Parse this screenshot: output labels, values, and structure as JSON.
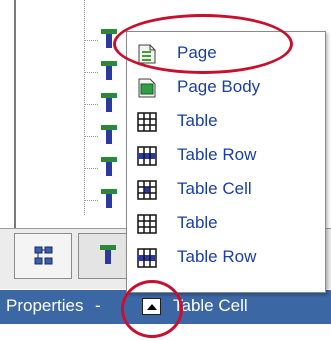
{
  "menu": {
    "items": [
      {
        "label": "Page",
        "icon": "page-icon"
      },
      {
        "label": "Page Body",
        "icon": "page-body-icon"
      },
      {
        "label": "Table",
        "icon": "table-icon"
      },
      {
        "label": "Table Row",
        "icon": "table-row-icon"
      },
      {
        "label": "Table Cell",
        "icon": "table-cell-icon"
      },
      {
        "label": "Table",
        "icon": "table-icon"
      },
      {
        "label": "Table Row",
        "icon": "table-row-icon"
      }
    ]
  },
  "status_bar": {
    "label": "Properties",
    "separator": "-",
    "current": "Table Cell"
  },
  "tabs": [
    {
      "icon": "outline-icon"
    },
    {
      "icon": "tree-icon"
    }
  ],
  "colors": {
    "status_bar_bg": "#3c67a5",
    "menu_text": "#1a3fa0",
    "annotation": "#c8102e"
  }
}
